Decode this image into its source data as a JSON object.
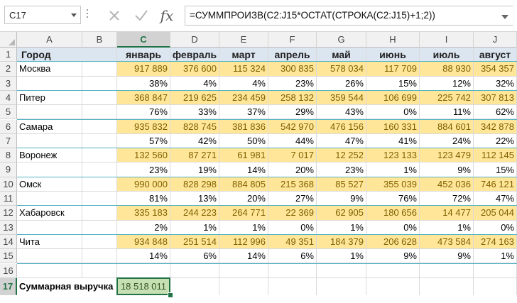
{
  "name_box": "C17",
  "formula": "=СУММПРОИЗВ(C2:J15*ОСТАТ(СТРОКА(C2:J15)+1;2))",
  "cancel_icon": "✕",
  "enter_icon": "✓",
  "fx_icon": "fx",
  "columns": [
    "A",
    "B",
    "C",
    "D",
    "E",
    "F",
    "G",
    "H",
    "I",
    "J"
  ],
  "selected_column": "C",
  "rows": [
    "1",
    "2",
    "3",
    "4",
    "5",
    "6",
    "7",
    "8",
    "9",
    "10",
    "11",
    "12",
    "13",
    "14",
    "15",
    "16",
    "17"
  ],
  "selected_row": "17",
  "header": {
    "city": "Город",
    "months": [
      "январь",
      "февраль",
      "март",
      "апрель",
      "май",
      "июнь",
      "июль",
      "август"
    ]
  },
  "cities": [
    {
      "name": "Москва",
      "revenue": [
        "917 889",
        "376 600",
        "115 324",
        "300 835",
        "578 034",
        "117 709",
        "88 930",
        "354 357"
      ],
      "percent": [
        "38%",
        "4%",
        "4%",
        "23%",
        "26%",
        "15%",
        "12%",
        "32%"
      ]
    },
    {
      "name": "Питер",
      "revenue": [
        "368 847",
        "219 625",
        "234 459",
        "258 132",
        "359 544",
        "106 699",
        "225 742",
        "307 813"
      ],
      "percent": [
        "76%",
        "33%",
        "37%",
        "29%",
        "43%",
        "0%",
        "11%",
        "62%"
      ]
    },
    {
      "name": "Самара",
      "revenue": [
        "935 832",
        "828 745",
        "381 836",
        "542 970",
        "476 156",
        "160 331",
        "884 601",
        "342 878"
      ],
      "percent": [
        "57%",
        "42%",
        "50%",
        "44%",
        "47%",
        "41%",
        "24%",
        "22%"
      ]
    },
    {
      "name": "Воронеж",
      "revenue": [
        "132 560",
        "87 271",
        "61 981",
        "7 017",
        "12 252",
        "123 133",
        "123 479",
        "112 145"
      ],
      "percent": [
        "23%",
        "19%",
        "14%",
        "20%",
        "23%",
        "1%",
        "9%",
        "15%"
      ]
    },
    {
      "name": "Омск",
      "revenue": [
        "990 000",
        "828 298",
        "884 805",
        "215 368",
        "85 527",
        "355 039",
        "452 036",
        "746 121"
      ],
      "percent": [
        "81%",
        "13%",
        "20%",
        "27%",
        "9%",
        "76%",
        "72%",
        "47%"
      ]
    },
    {
      "name": "Хабаровск",
      "revenue": [
        "335 183",
        "244 223",
        "264 771",
        "22 369",
        "62 905",
        "180 656",
        "14 477",
        "205 044"
      ],
      "percent": [
        "2%",
        "1%",
        "1%",
        "0%",
        "1%",
        "0%",
        "1%",
        "0%"
      ]
    },
    {
      "name": "Чита",
      "revenue": [
        "934 848",
        "251 514",
        "112 996",
        "49 351",
        "184 379",
        "206 628",
        "473 584",
        "274 163"
      ],
      "percent": [
        "14%",
        "6%",
        "14%",
        "6%",
        "1%",
        "9%",
        "9%",
        "1%"
      ]
    }
  ],
  "total": {
    "label": "Суммарная выручка",
    "value": "18 518 011"
  },
  "colors": {
    "header_fill": "#dce6f1",
    "revenue_fill": "#ffe699",
    "total_fill": "#c6e0b4",
    "selection": "#217346",
    "separator": "#52b3c4"
  }
}
